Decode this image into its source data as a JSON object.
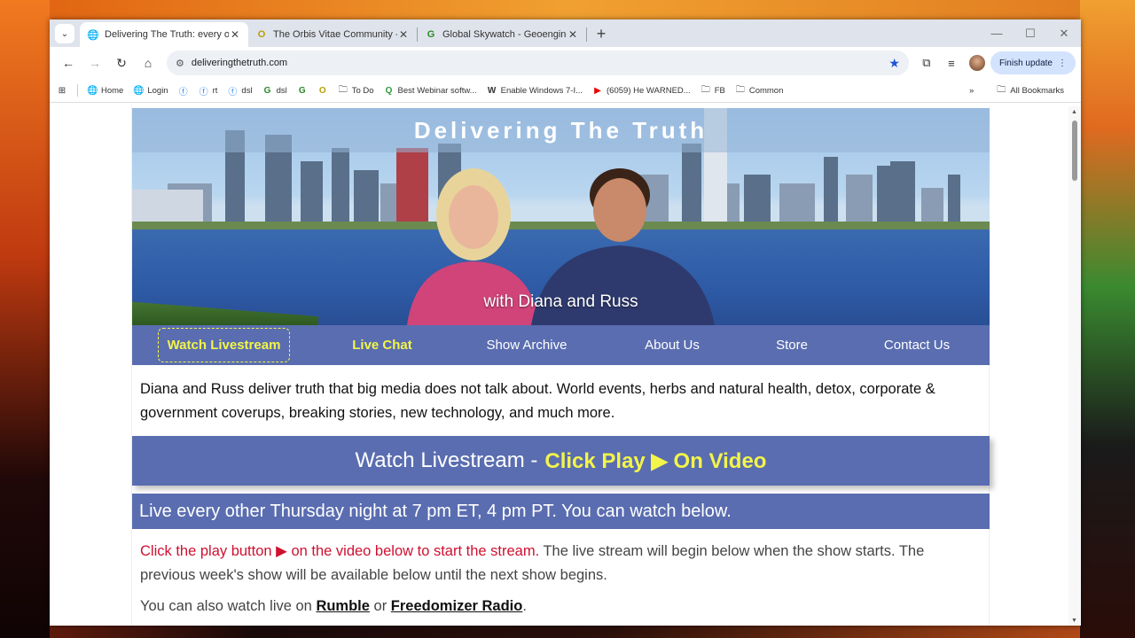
{
  "browser": {
    "tabs": [
      {
        "title": "Delivering The Truth: every othe",
        "favicon": "globe-icon",
        "active": true
      },
      {
        "title": "The Orbis Vitae Community - F",
        "favicon": "O",
        "active": false
      },
      {
        "title": "Global Skywatch - Geoengineer",
        "favicon": "G",
        "active": false
      }
    ],
    "url": "deliveringthetruth.com",
    "update_label": "Finish update",
    "bookmarks": [
      {
        "label": "Home",
        "icon": "globe-icon"
      },
      {
        "label": "Login",
        "icon": "globe-icon"
      },
      {
        "label": "",
        "icon": "facebook-icon"
      },
      {
        "label": "rt",
        "icon": "facebook-icon"
      },
      {
        "label": "dsl",
        "icon": "facebook-icon"
      },
      {
        "label": "dsl",
        "icon": "g-icon"
      },
      {
        "label": "",
        "icon": "g-icon"
      },
      {
        "label": "",
        "icon": "o-icon"
      },
      {
        "label": "To Do",
        "icon": "folder-icon"
      },
      {
        "label": "Best Webinar softw...",
        "icon": "q-icon"
      },
      {
        "label": "Enable Windows 7-I...",
        "icon": "w-icon"
      },
      {
        "label": "(6059) He WARNED...",
        "icon": "youtube-icon"
      },
      {
        "label": "FB",
        "icon": "folder-icon"
      },
      {
        "label": "Common",
        "icon": "folder-icon"
      }
    ],
    "all_bookmarks_label": "All Bookmarks"
  },
  "site": {
    "banner_title": "Delivering The Truth",
    "banner_subtitle": "with Diana and Russ",
    "nav": [
      {
        "label": "Watch Livestream"
      },
      {
        "label": "Live Chat"
      },
      {
        "label": "Show Archive"
      },
      {
        "label": "About Us"
      },
      {
        "label": "Store"
      },
      {
        "label": "Contact Us"
      }
    ],
    "intro": "Diana and Russ deliver truth that big media does not talk about. World events, herbs and natural health, detox, corporate & government coverups, breaking stories, new technology, and much more.",
    "bar1_prefix": "Watch Livestream -",
    "bar1_highlight": "Click Play ▶ On Video",
    "bar2": "Live every other Thursday night at 7 pm ET, 4 pm PT. You can watch below.",
    "para_red": "Click the play button ▶ on the video below to start the stream.",
    "para_rest": " The live stream will begin below when the show starts. The previous week's show will be available below until the next show begins.",
    "para2_prefix": "You can also watch live on ",
    "rumble": "Rumble",
    "para2_or": " or ",
    "freedomizer": "Freedomizer Radio",
    "para2_end": "."
  },
  "colors": {
    "nav_bg": "#5a6db0",
    "highlight": "#f3f54a",
    "red_text": "#d01030"
  }
}
